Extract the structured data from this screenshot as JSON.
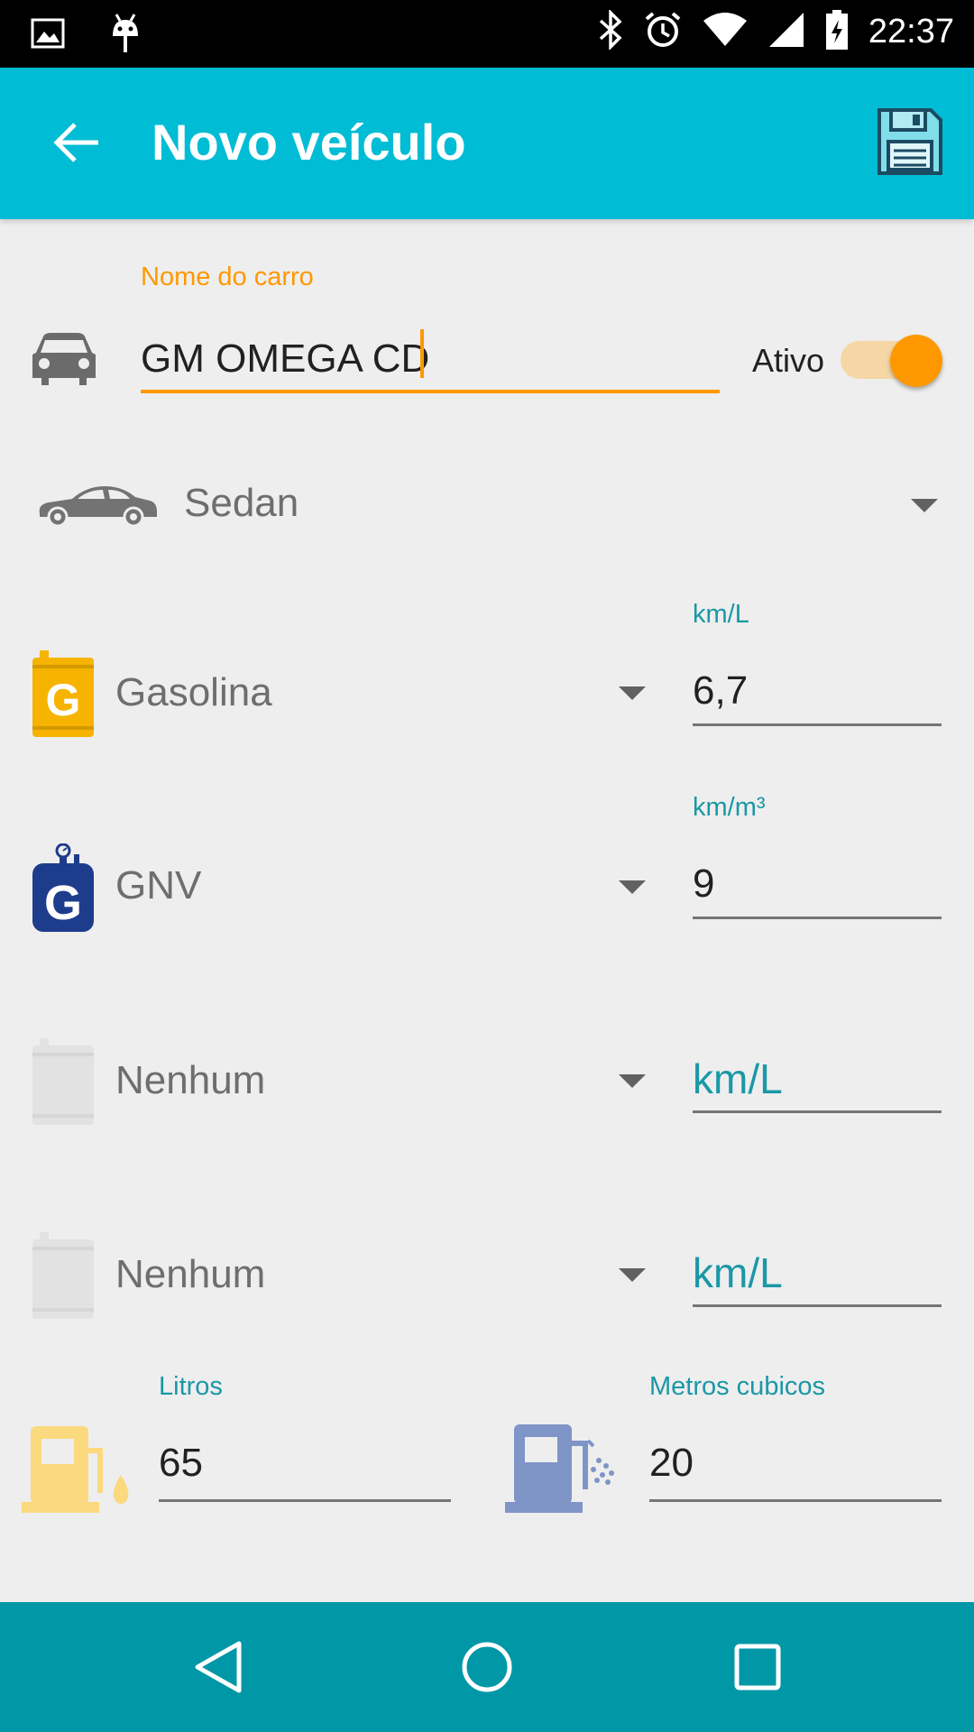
{
  "status_bar": {
    "time": "22:37",
    "icons": [
      "image-icon",
      "android-icon",
      "bluetooth-icon",
      "alarm-icon",
      "wifi-icon",
      "signal-icon",
      "battery-charging-icon"
    ]
  },
  "app_bar": {
    "title": "Novo veículo",
    "back_icon": "arrow-back-icon",
    "save_icon": "floppy-disk-icon",
    "color": "#00bcd4"
  },
  "car_name": {
    "label": "Nome do carro",
    "value": "GM OMEGA CD",
    "icon": "car-front-icon"
  },
  "active_switch": {
    "label": "Ativo",
    "checked": true
  },
  "body_type": {
    "selected": "Sedan",
    "icon": "sedan-icon"
  },
  "fuels": [
    {
      "type": "Gasolina",
      "unit_label": "km/L",
      "value": "6,7",
      "icon": "gasoline-can-icon"
    },
    {
      "type": "GNV",
      "unit_label": "km/m³",
      "value": "9",
      "icon": "gnv-cylinder-icon"
    },
    {
      "type": "Nenhum",
      "placeholder": "km/L",
      "value": "",
      "icon": "empty-can-icon"
    },
    {
      "type": "Nenhum",
      "placeholder": "km/L",
      "value": "",
      "icon": "empty-can-icon"
    }
  ],
  "tanks": {
    "liters": {
      "label": "Litros",
      "value": "65",
      "icon": "fuel-pump-icon"
    },
    "cubic_meters": {
      "label": "Metros cubicos",
      "value": "20",
      "icon": "gas-pump-icon"
    }
  },
  "nav_bar": {
    "color": "#0097a7",
    "buttons": [
      "back-nav-icon",
      "home-nav-icon",
      "recents-nav-icon"
    ]
  }
}
